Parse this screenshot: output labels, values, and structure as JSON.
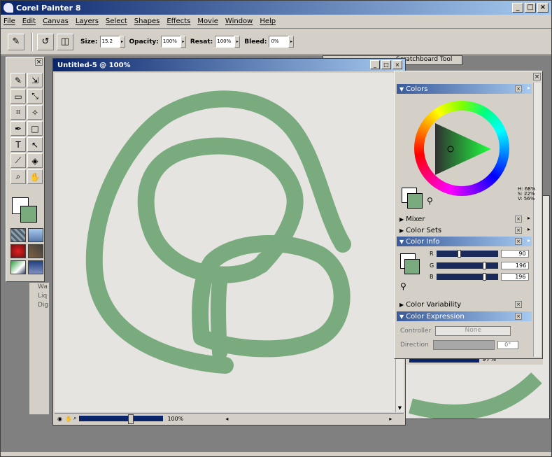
{
  "app": {
    "title": "Corel Painter 8"
  },
  "window_controls": {
    "minimize": "_",
    "maximize": "□",
    "close": "×"
  },
  "menu": [
    "File",
    "Edit",
    "Canvas",
    "Layers",
    "Select",
    "Shapes",
    "Effects",
    "Movie",
    "Window",
    "Help"
  ],
  "propbar": {
    "size_label": "Size:",
    "size_value": "15.2",
    "opacity_label": "Opacity:",
    "opacity_value": "100%",
    "resat_label": "Resat:",
    "resat_value": "100%",
    "bleed_label": "Bleed:",
    "bleed_value": "0%"
  },
  "bg_window": {
    "label": "Scratchboard Tool"
  },
  "left_fragments": [
    "Wa",
    "Liq",
    "Dig"
  ],
  "document": {
    "title": "Untitled-5 @ 100%",
    "zoom": "100%"
  },
  "bg_document": {
    "zoom": "97%"
  },
  "palette": {
    "sections": {
      "colors": "Colors",
      "mixer": "Mixer",
      "color_sets": "Color Sets",
      "color_info": "Color Info",
      "color_variability": "Color Variability",
      "color_expression": "Color Expression"
    },
    "hsv": {
      "h": "H: 68%",
      "s": "S: 22%",
      "v": "V: 56%"
    },
    "rgb": {
      "r_label": "R",
      "r_value": "90",
      "g_label": "G",
      "g_value": "196",
      "b_label": "B",
      "b_value": "196"
    },
    "expression": {
      "controller_label": "Controller",
      "controller_value": "None",
      "direction_label": "Direction",
      "direction_value": "0°"
    }
  },
  "colors": {
    "stroke": "#7aab7e",
    "title_bar": "#0a246a"
  }
}
